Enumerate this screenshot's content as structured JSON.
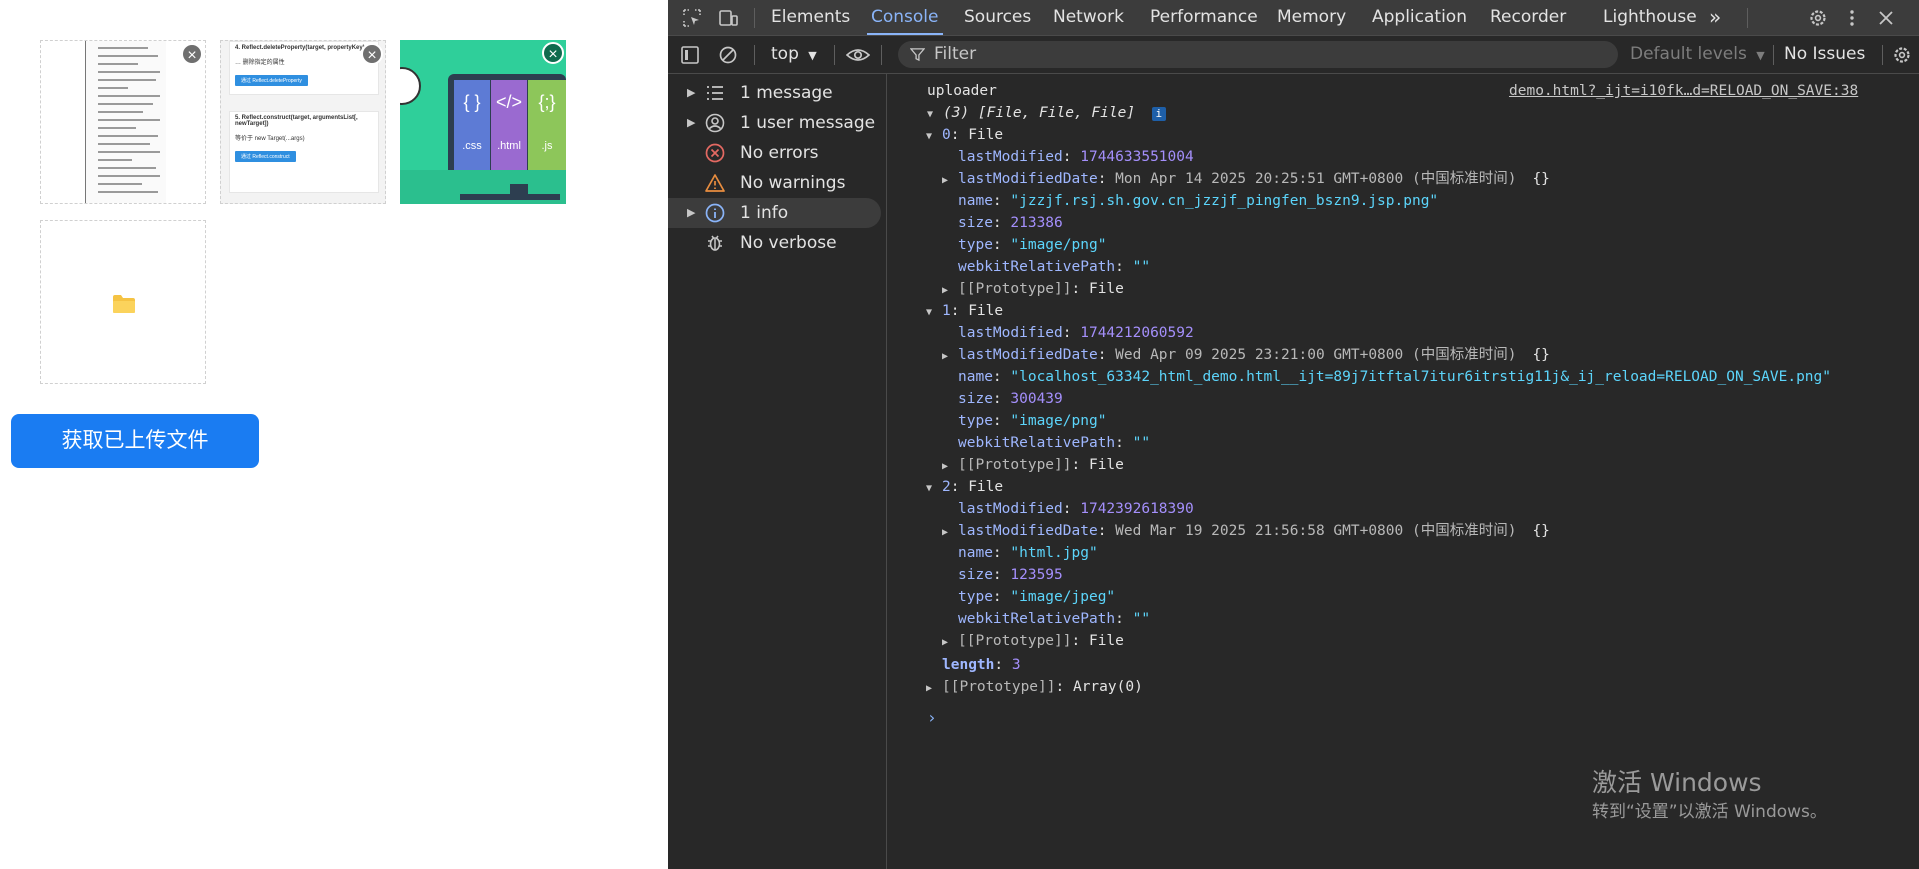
{
  "page": {
    "upload_button": "获取已上传文件",
    "thumbs": {
      "card1_title": "4. Reflect.deleteProperty(target, propertyKey)",
      "card1_text": "… 删除指定的属性",
      "card1_btn": "通过 Reflect.deleteProperty",
      "card2_title": "5. Reflect.construct(target, argumentsList[, newTarget])",
      "card2_text": "等价于 new Target(...args)",
      "card2_btn": "通过 Reflect.construct",
      "code_labels": [
        ".css",
        ".html",
        ".js"
      ],
      "code_glyphs": [
        "{ }",
        "</>",
        "{;}"
      ]
    }
  },
  "devtools": {
    "tabs": [
      "Elements",
      "Console",
      "Sources",
      "Network",
      "Performance",
      "Memory",
      "Application",
      "Recorder",
      "Lighthouse"
    ],
    "active_tab": "Console",
    "more_tabs": "»",
    "toolbar": {
      "context": "top",
      "filter_placeholder": "Filter",
      "levels": "Default levels",
      "issues": "No Issues"
    },
    "sidebar": [
      {
        "label": "1 message",
        "icon": "list-icon",
        "expandable": true
      },
      {
        "label": "1 user message",
        "icon": "user-icon",
        "expandable": true
      },
      {
        "label": "No errors",
        "icon": "error-icon",
        "expandable": false
      },
      {
        "label": "No warnings",
        "icon": "warning-icon",
        "expandable": false
      },
      {
        "label": "1 info",
        "icon": "info-icon",
        "expandable": true
      },
      {
        "label": "No verbose",
        "icon": "bug-icon",
        "expandable": false
      }
    ],
    "console": {
      "log_label": "uploader",
      "source_link": "demo.html?_ijt=i10fk…d=RELOAD_ON_SAVE:38",
      "array_summary": "(3) [File, File, File]",
      "files": [
        {
          "index": "0",
          "lastModified": "1744633551004",
          "lastModifiedDate": "Mon Apr 14 2025 20:25:51 GMT+0800 (中国标准时间)",
          "name": "\"jzzjf.rsj.sh.gov.cn_jzzjf_pingfen_bszn9.jsp.png\"",
          "size": "213386",
          "type": "\"image/png\"",
          "webkitRelativePath": "\"\""
        },
        {
          "index": "1",
          "lastModified": "1744212060592",
          "lastModifiedDate": "Wed Apr 09 2025 23:21:00 GMT+0800 (中国标准时间)",
          "name": "\"localhost_63342_html_demo.html__ijt=89j7itftal7itur6itrstig11j&_ij_reload=RELOAD_ON_SAVE.png\"",
          "size": "300439",
          "type": "\"image/png\"",
          "webkitRelativePath": "\"\""
        },
        {
          "index": "2",
          "lastModified": "1742392618390",
          "lastModifiedDate": "Wed Mar 19 2025 21:56:58 GMT+0800 (中国标准时间)",
          "name": "\"html.jpg\"",
          "size": "123595",
          "type": "\"image/jpeg\"",
          "webkitRelativePath": "\"\""
        }
      ],
      "keys": {
        "lastModified": "lastModified",
        "lastModifiedDate": "lastModifiedDate",
        "name": "name",
        "size": "size",
        "type": "type",
        "webkitRelativePath": "webkitRelativePath",
        "prototype": "[[Prototype]]",
        "file": "File",
        "braces": "{}",
        "length_key": "length",
        "length_value": "3",
        "array_proto": "Array(0)"
      },
      "prompt": "›"
    }
  },
  "watermark": {
    "line1": "激活 Windows",
    "line2": "转到“设置”以激活 Windows。"
  },
  "colors": {
    "accent": "#8ab4f8",
    "button": "#1a7cf2",
    "error": "#e46962",
    "warning": "#e88d3f",
    "info": "#8ab4f8"
  }
}
